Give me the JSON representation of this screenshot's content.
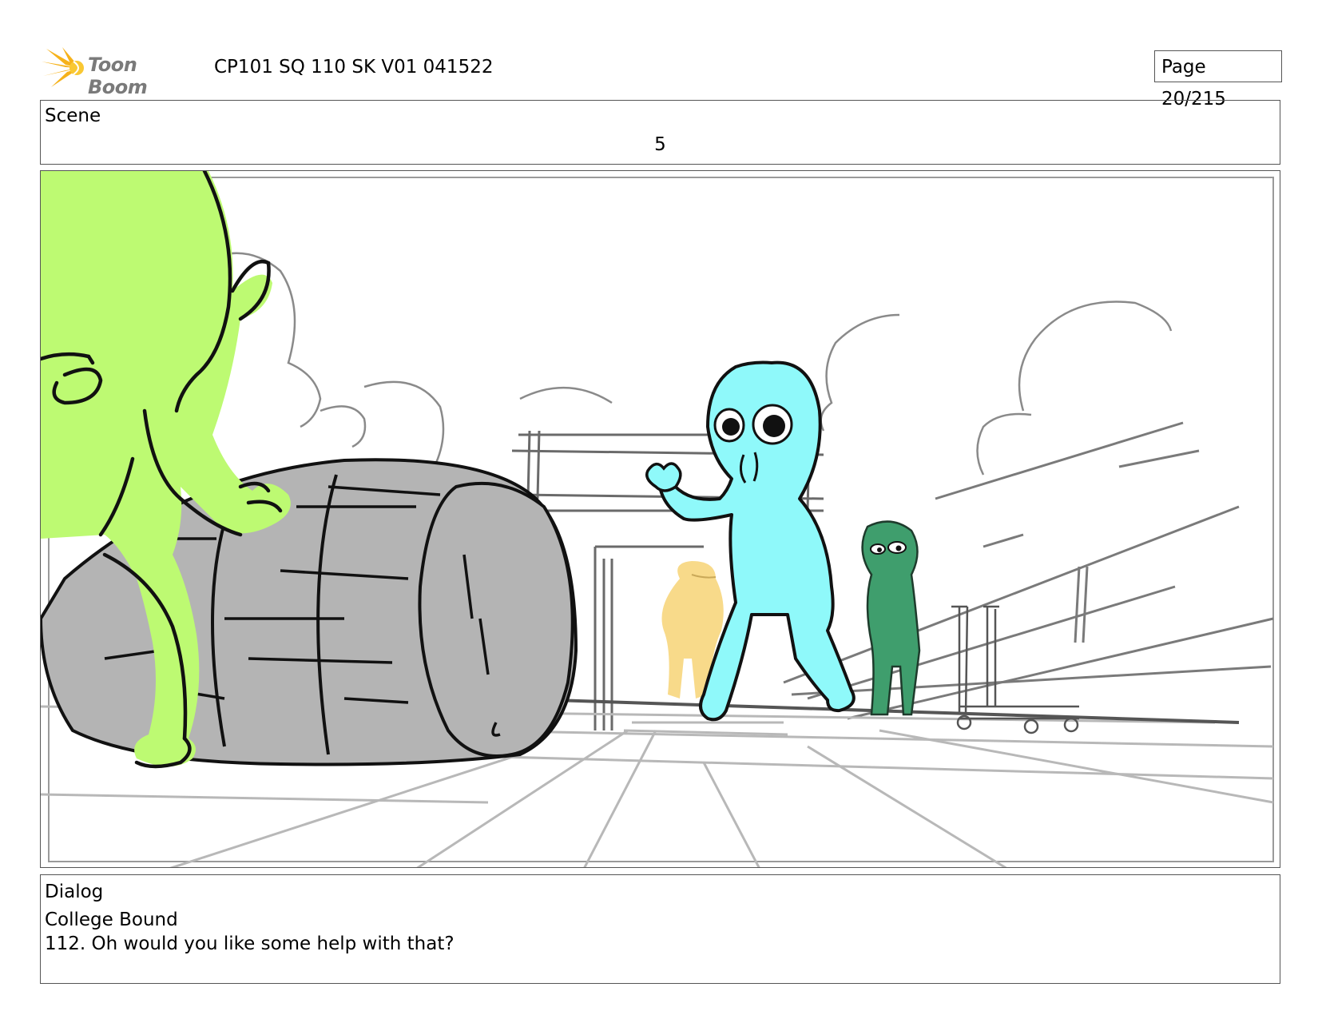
{
  "header": {
    "logo_text": "Toon Boom",
    "doc_title": "CP101 SQ 110 SK V01 041522",
    "page_label": "Page  20/215"
  },
  "scene": {
    "label": "Scene",
    "number": "5"
  },
  "dialog": {
    "label": "Dialog",
    "speaker": "College Bound",
    "line": "112. Oh would you like some help with that?"
  },
  "colors": {
    "green_character": "#bdfa72",
    "blue_character": "#8ff9fa",
    "dark_green_character": "#3f9e6d",
    "yellow_character": "#f8da8a",
    "barrel": "#b4b4b4",
    "logo_sun": "#f6b21a"
  }
}
